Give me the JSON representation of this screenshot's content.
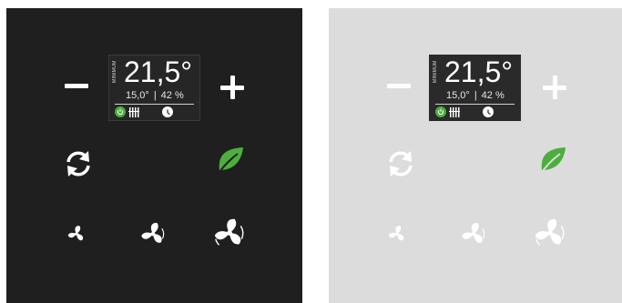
{
  "display": {
    "mode_label": "MINIMUM",
    "temperature": "21,5°",
    "setpoint": "15,0°",
    "separator": "|",
    "humidity": "42 %"
  },
  "colors": {
    "dark_panel": "#1f1f1f",
    "light_panel": "#dcdcdc",
    "accent_green": "#4caf3d",
    "icon_white": "#ffffff"
  },
  "icons": [
    "minus-icon",
    "plus-icon",
    "power-icon",
    "radiator-icon",
    "clock-icon",
    "sync-icon",
    "leaf-icon",
    "fan-low-icon",
    "fan-medium-icon",
    "fan-high-icon"
  ]
}
